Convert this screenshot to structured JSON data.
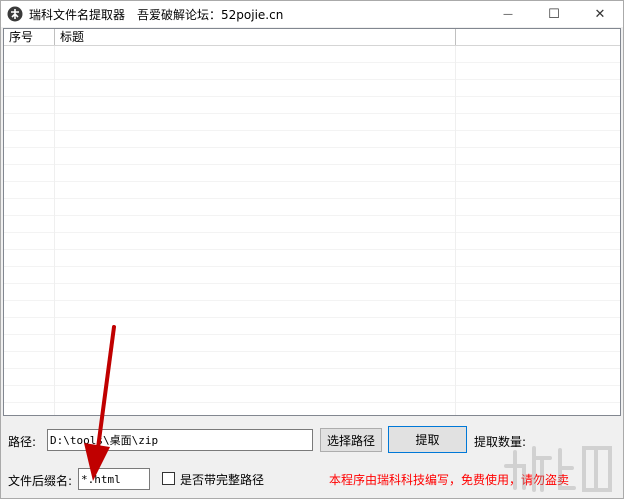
{
  "window": {
    "app_title": "瑞科文件名提取器",
    "forum_text": "吾爱破解论坛：52pojie.cn",
    "minimize_glyph": "—",
    "maximize_glyph": "☐",
    "close_glyph": "✕"
  },
  "listview": {
    "columns": [
      {
        "label": "序号"
      },
      {
        "label": "标题"
      },
      {
        "label": ""
      }
    ]
  },
  "path": {
    "label": "路径:",
    "value": "D:\\tools\\桌面\\zip",
    "choose_button": "选择路径",
    "extract_button": "提取",
    "count_label": "提取数量:"
  },
  "suffix": {
    "label": "文件后缀名:",
    "value": "*.html",
    "full_path_checkbox": "是否带完整路径",
    "checked": false
  },
  "footer": {
    "copyright": "本程序由瑞科科技编写，免费使用，请勿盗卖"
  },
  "colors": {
    "copyright": "#ff0000",
    "annotation_arrow": "#c00000",
    "focus_border": "#0078d7"
  }
}
